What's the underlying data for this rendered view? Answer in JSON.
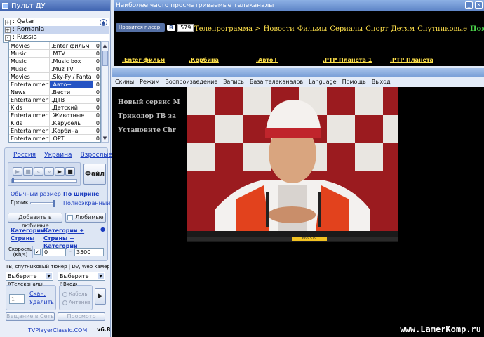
{
  "remote": {
    "title": "Пульт ДУ",
    "tree": [
      {
        "sign": "+",
        "label": ": Qatar"
      },
      {
        "sign": "+",
        "label": ": Romania"
      },
      {
        "sign": "-",
        "label": ": Russia"
      }
    ],
    "channels": [
      {
        "genre": "Movies",
        "name": ".Enter фильм",
        "num": "0"
      },
      {
        "genre": "Music",
        "name": ".MTV",
        "num": "0"
      },
      {
        "genre": "Music",
        "name": ".Music box",
        "num": "0"
      },
      {
        "genre": "Music",
        "name": ".Muz TV",
        "num": "0"
      },
      {
        "genre": "Movies",
        "name": ".Sky-Fy / Fanta",
        "num": "0"
      },
      {
        "genre": "Entertainment",
        "name": ".Авто+",
        "num": "0",
        "selected": true
      },
      {
        "genre": "News",
        "name": ".Вести",
        "num": "0"
      },
      {
        "genre": "Entertainment",
        "name": ".ДТВ",
        "num": "0"
      },
      {
        "genre": "Kids",
        "name": ".Детский",
        "num": "0"
      },
      {
        "genre": "Entertainment",
        "name": ".Животные",
        "num": "0"
      },
      {
        "genre": "Kids",
        "name": ".Карусель",
        "num": "0"
      },
      {
        "genre": "Entertainment",
        "name": ".Корбина",
        "num": "0"
      },
      {
        "genre": "Entertainment",
        "name": ".ОРТ",
        "num": "0"
      }
    ],
    "countries": {
      "russia": "Россия",
      "ukraine": "Украина",
      "adult": "Взрослые"
    },
    "file_button": "Файл",
    "normal_size": "Обычный размер",
    "fit_width": "По ширине",
    "volume_label": "Громк.",
    "fullscreen": "Полноэкранный",
    "add_fav": "Добавить в любимые",
    "favorites": "Любимые",
    "cat1": "Категории",
    "cat_countries": "Категории + Страны",
    "countries_link": "Страны",
    "countries_cat": "Страны + Категории",
    "speed_label": "Скорость\n(Kb/s)",
    "speed_from": "0",
    "speed_to": "3500",
    "speed_sep": "-",
    "tuner_label": "ТВ, спутниковый тюнер | DV, Web камера",
    "video_select": "Выберите видео",
    "audio_select": "Выберите аудио",
    "tv_channels_label": "Телеканалы",
    "channel_num": "1",
    "scan": "Скан.",
    "delete": "Удалить",
    "input_label": "Вход",
    "cable": "Кабель",
    "antenna": "Антенна",
    "stream_button": "Вещание в Сеть",
    "preview_button": "Просмотр",
    "site": "TVPlayerClassic.COM",
    "version": "v6.8"
  },
  "guide": {
    "title": "Наиболее часто просматриваемые телеканалы",
    "like": "Нравится плеер!",
    "vk": "B",
    "like_count": "579",
    "nav": [
      "Телепрограмма >",
      "Новости",
      "Фильмы",
      "Сериалы",
      "Спорт",
      "Детям",
      "Спутниковые"
    ],
    "nav_highlight": "Помощь",
    "now": [
      ".Enter фильм",
      ".Корбина",
      ".Авто+",
      ".РТР Планета 1",
      ".РТР Планета"
    ]
  },
  "player": {
    "menu": [
      "Скины",
      "Режим",
      "Воспроизведение",
      "Запись",
      "База телеканалов",
      "Language",
      "Помощь",
      "Выход"
    ],
    "side_links": [
      "Новый сервис М",
      "Триколор ТВ за",
      "Установите Chr"
    ],
    "seek_text": "666 519",
    "watermark": "www.LamerKomp.ru"
  },
  "colors": {
    "link": "#1b3cbf",
    "guide_link": "#ffe14a",
    "highlight": "#4ad14a",
    "selection": "#2553c3"
  }
}
